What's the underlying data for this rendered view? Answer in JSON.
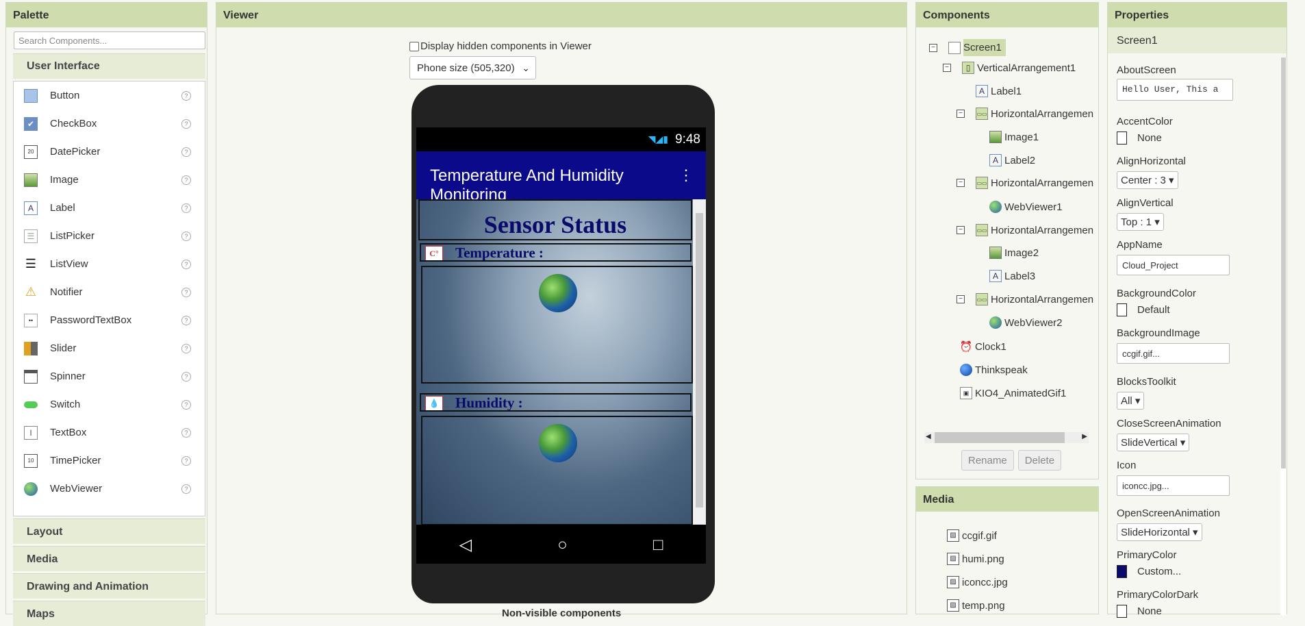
{
  "palette": {
    "title": "Palette",
    "search_placeholder": "Search Components...",
    "selected_category": "User Interface",
    "items": [
      {
        "label": "Button",
        "icon": "button-icon"
      },
      {
        "label": "CheckBox",
        "icon": "checkbox-icon"
      },
      {
        "label": "DatePicker",
        "icon": "datepicker-icon"
      },
      {
        "label": "Image",
        "icon": "image-icon"
      },
      {
        "label": "Label",
        "icon": "label-icon"
      },
      {
        "label": "ListPicker",
        "icon": "listpicker-icon"
      },
      {
        "label": "ListView",
        "icon": "listview-icon"
      },
      {
        "label": "Notifier",
        "icon": "notifier-icon"
      },
      {
        "label": "PasswordTextBox",
        "icon": "password-icon"
      },
      {
        "label": "Slider",
        "icon": "slider-icon"
      },
      {
        "label": "Spinner",
        "icon": "spinner-icon"
      },
      {
        "label": "Switch",
        "icon": "switch-icon"
      },
      {
        "label": "TextBox",
        "icon": "textbox-icon"
      },
      {
        "label": "TimePicker",
        "icon": "timepicker-icon"
      },
      {
        "label": "WebViewer",
        "icon": "webviewer-icon"
      }
    ],
    "categories": [
      "Layout",
      "Media",
      "Drawing and Animation",
      "Maps"
    ],
    "help": "?"
  },
  "viewer": {
    "title": "Viewer",
    "display_hidden": "Display hidden components in Viewer",
    "size_option": "Phone size (505,320)",
    "status_time": "9:48",
    "app_title": "Temperature And Humidity Monitoring",
    "sensor_title": "Sensor Status",
    "temperature_label": "Temperature :",
    "humidity_label": "Humidity :",
    "temp_icon_text": "C°",
    "humi_icon_text": "💧",
    "nonvisible": "Non-visible components",
    "nav": {
      "back": "◁",
      "home": "○",
      "recent": "□"
    }
  },
  "components": {
    "title": "Components",
    "tree": [
      {
        "label": "Screen1",
        "icon": "screen-icon",
        "toggle": "⊟"
      },
      {
        "label": "VerticalArrangement1",
        "icon": "vertical-arrangement-icon",
        "toggle": "⊟"
      },
      {
        "label": "Label1",
        "icon": "label-icon"
      },
      {
        "label": "HorizontalArrangemen",
        "icon": "horizontal-arrangement-icon",
        "toggle": "⊟"
      },
      {
        "label": "Image1",
        "icon": "image-icon"
      },
      {
        "label": "Label2",
        "icon": "label-icon"
      },
      {
        "label": "HorizontalArrangemen",
        "icon": "horizontal-arrangement-icon",
        "toggle": "⊟"
      },
      {
        "label": "WebViewer1",
        "icon": "webviewer-icon"
      },
      {
        "label": "HorizontalArrangemen",
        "icon": "horizontal-arrangement-icon",
        "toggle": "⊟"
      },
      {
        "label": "Image2",
        "icon": "image-icon"
      },
      {
        "label": "Label3",
        "icon": "label-icon"
      },
      {
        "label": "HorizontalArrangemen",
        "icon": "horizontal-arrangement-icon",
        "toggle": "⊟"
      },
      {
        "label": "WebViewer2",
        "icon": "webviewer-icon"
      },
      {
        "label": "Clock1",
        "icon": "clock-icon"
      },
      {
        "label": "Thinkspeak",
        "icon": "web-icon"
      },
      {
        "label": "KIO4_AnimatedGif1",
        "icon": "extension-icon"
      }
    ],
    "rename": "Rename",
    "delete": "Delete"
  },
  "media": {
    "title": "Media",
    "files": [
      "ccgif.gif",
      "humi.png",
      "iconcc.jpg",
      "temp.png"
    ]
  },
  "properties": {
    "title": "Properties",
    "component": "Screen1",
    "about_label": "AboutScreen",
    "about_value": "Hello User, This a",
    "accent_label": "AccentColor",
    "accent_value": "None",
    "align_h_label": "AlignHorizontal",
    "align_h_value": "Center : 3 ▾",
    "align_v_label": "AlignVertical",
    "align_v_value": "Top : 1 ▾",
    "appname_label": "AppName",
    "appname_value": "Cloud_Project",
    "bgcolor_label": "BackgroundColor",
    "bgcolor_value": "Default",
    "bgimage_label": "BackgroundImage",
    "bgimage_value": "ccgif.gif...",
    "blocks_label": "BlocksToolkit",
    "blocks_value": "All ▾",
    "close_anim_label": "CloseScreenAnimation",
    "close_anim_value": "SlideVertical ▾",
    "icon_label": "Icon",
    "icon_value": "iconcc.jpg...",
    "open_anim_label": "OpenScreenAnimation",
    "open_anim_value": "SlideHorizontal ▾",
    "primary_label": "PrimaryColor",
    "primary_value": "Custom...",
    "primary_color": "#0a0a6a",
    "primary_dark_label": "PrimaryColorDark",
    "primary_dark_value": "None"
  }
}
